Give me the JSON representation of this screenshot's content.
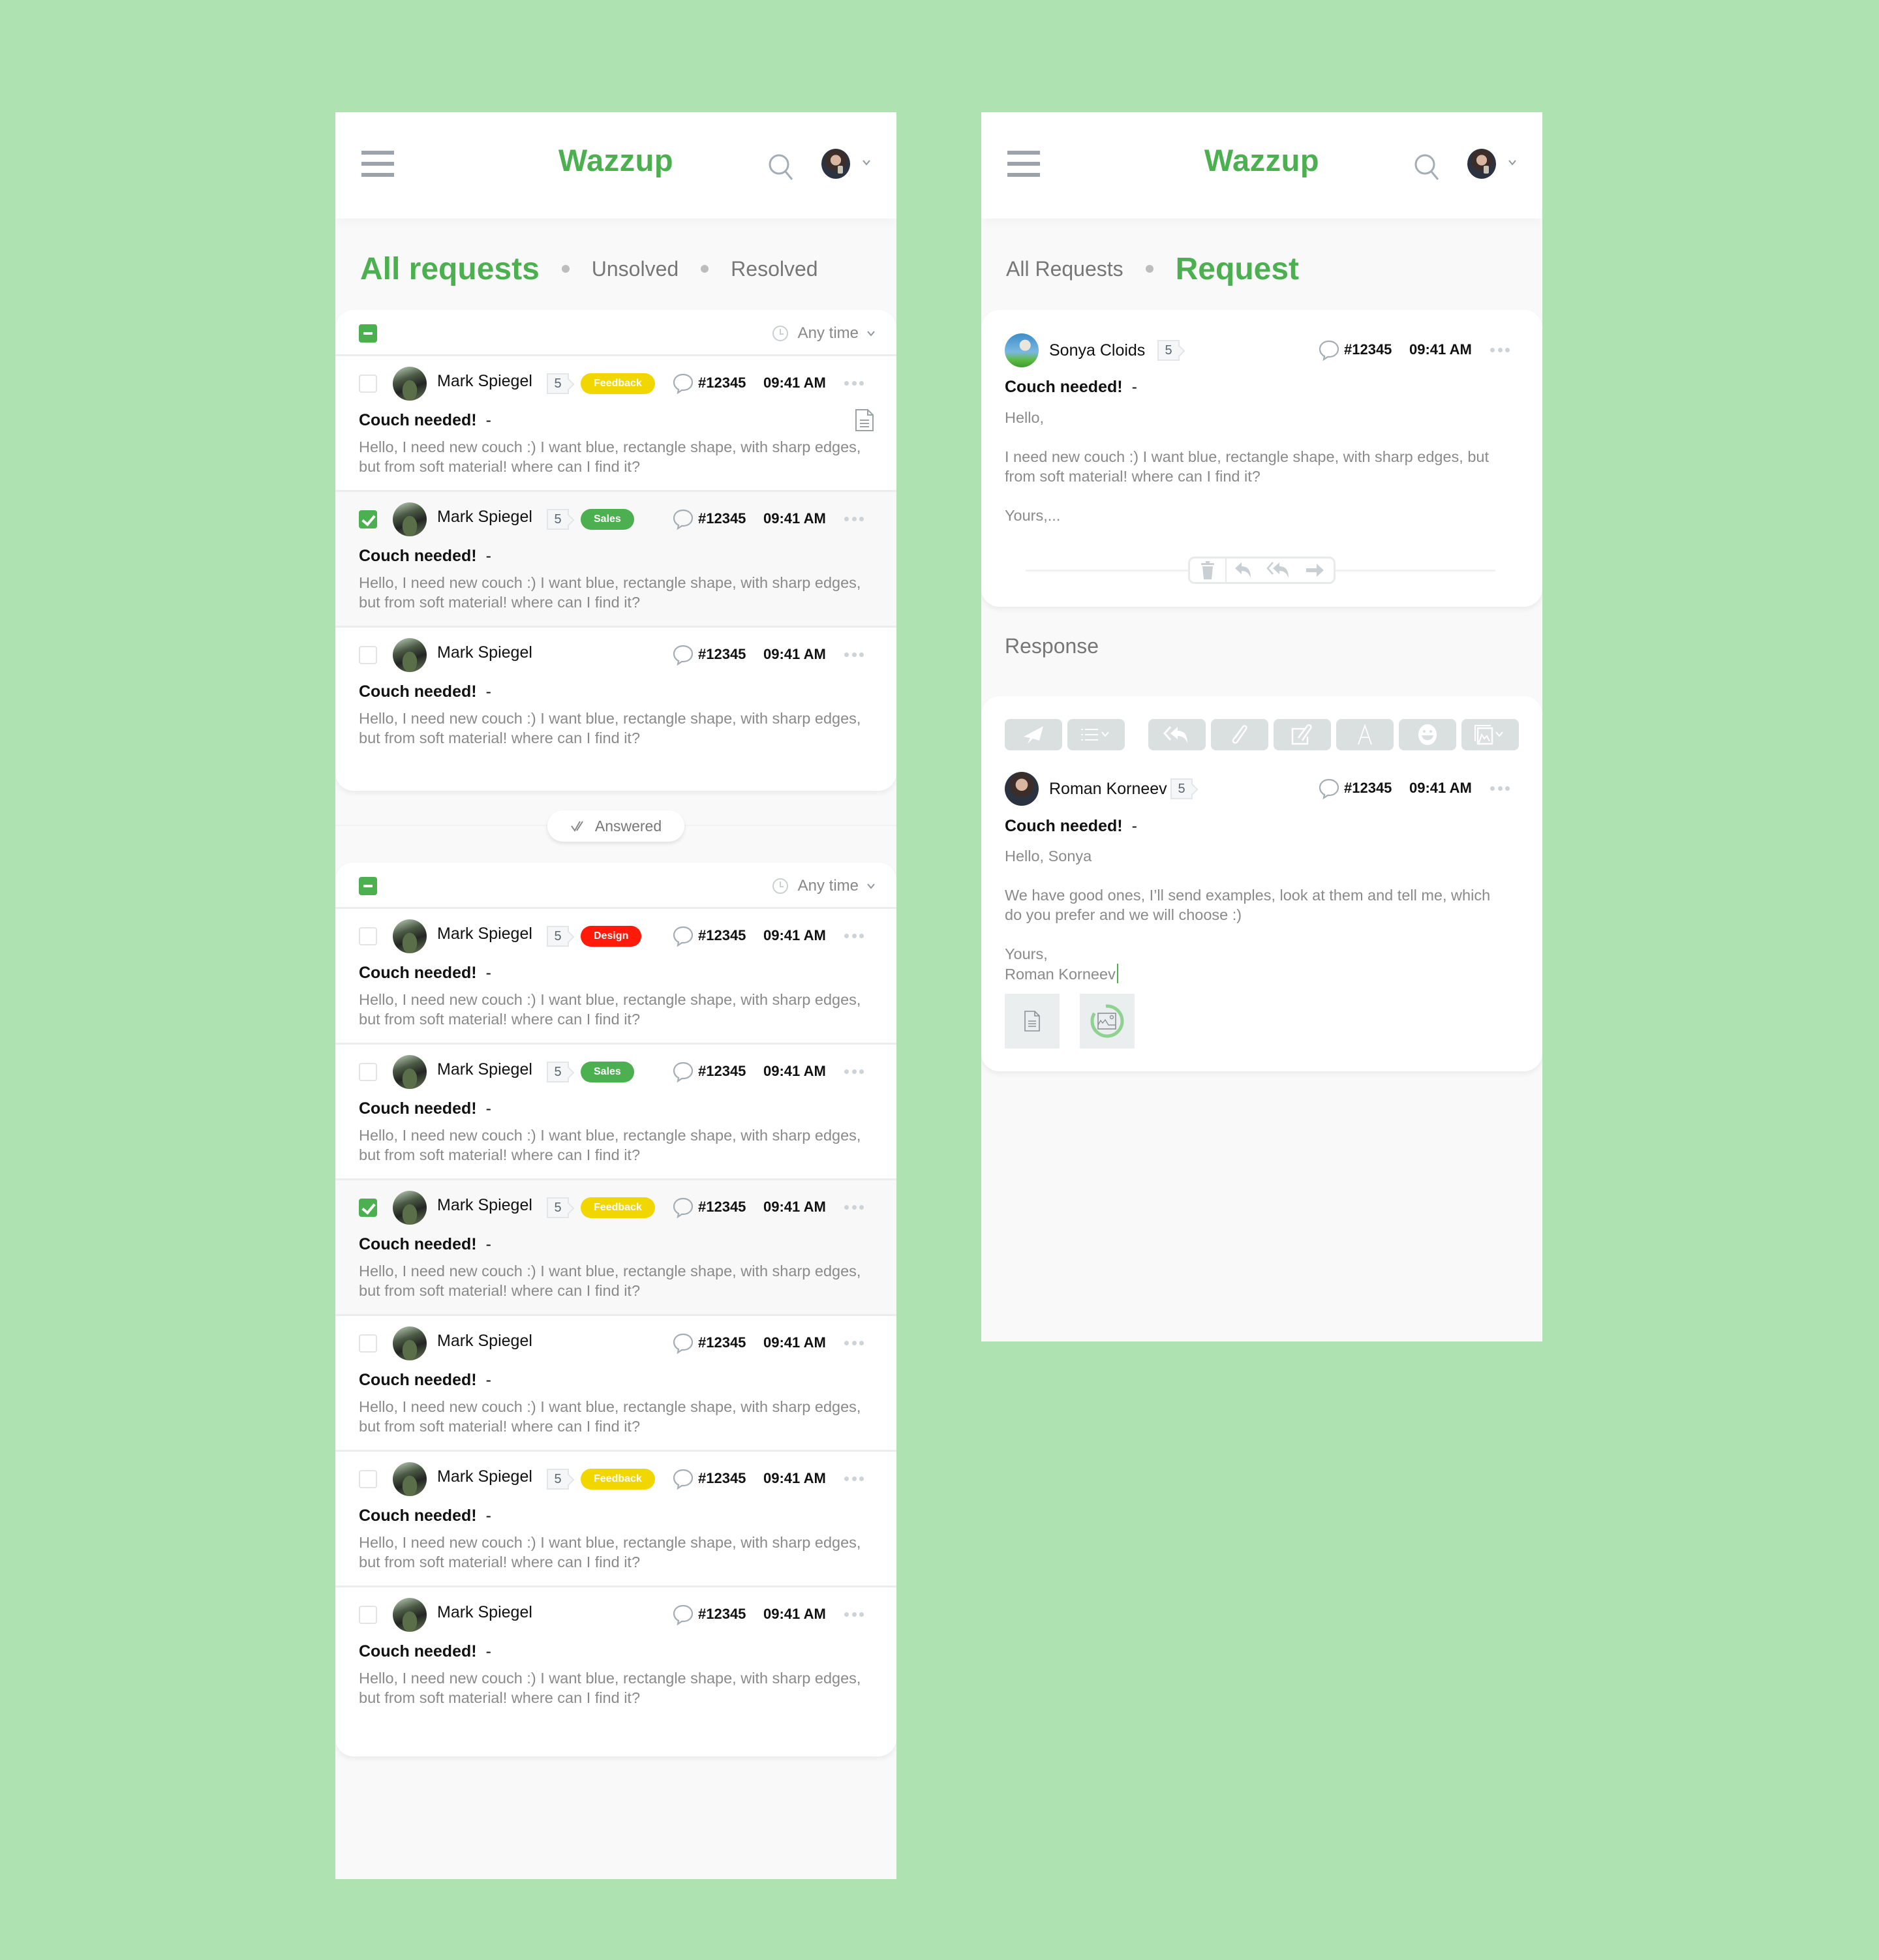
{
  "app": {
    "logo": "Wazzup",
    "accent_color": "#4CAF50",
    "background_color": "#AFE2B1"
  },
  "list_screen": {
    "tabs": [
      {
        "label": "All requests",
        "active": true
      },
      {
        "label": "Unsolved",
        "active": false
      },
      {
        "label": "Resolved",
        "active": false
      }
    ],
    "groups": [
      {
        "time_filter": "Any time",
        "bulk_select": "partial",
        "rows": [
          {
            "sender": "Mark Spiegel",
            "count": "5",
            "tag": "Feedback",
            "tag_color": "#F2D600",
            "ticket": "#12345",
            "time": "09:41 AM",
            "subject": "Couch needed!",
            "dash": "-",
            "preview": "Hello, I need new couch :) I want blue, rectangle shape, with sharp edges, but from soft material! where can I find it?",
            "checked": false,
            "has_attachment": true
          },
          {
            "sender": "Mark Spiegel",
            "count": "5",
            "tag": "Sales",
            "tag_color": "#4CAF50",
            "ticket": "#12345",
            "time": "09:41 AM",
            "subject": "Couch needed!",
            "dash": "-",
            "preview": "Hello, I need new couch :) I want blue, rectangle shape, with sharp edges, but from soft material! where can I find it?",
            "checked": true,
            "has_attachment": false
          },
          {
            "sender": "Mark Spiegel",
            "count": null,
            "tag": null,
            "tag_color": null,
            "ticket": "#12345",
            "time": "09:41 AM",
            "subject": "Couch needed!",
            "dash": "-",
            "preview": "Hello, I need new couch :) I want blue, rectangle shape, with sharp edges, but from soft material! where can I find it?",
            "checked": false,
            "has_attachment": false
          }
        ]
      },
      {
        "time_filter": "Any time",
        "bulk_select": "partial",
        "rows": [
          {
            "sender": "Mark Spiegel",
            "count": "5",
            "tag": "Design",
            "tag_color": "#FF1A0A",
            "ticket": "#12345",
            "time": "09:41 AM",
            "subject": "Couch needed!",
            "dash": "-",
            "preview": "Hello, I need new couch :) I want blue, rectangle shape, with sharp edges, but from soft material! where can I find it?",
            "checked": false,
            "has_attachment": false
          },
          {
            "sender": "Mark Spiegel",
            "count": "5",
            "tag": "Sales",
            "tag_color": "#4CAF50",
            "ticket": "#12345",
            "time": "09:41 AM",
            "subject": "Couch needed!",
            "dash": "-",
            "preview": "Hello, I need new couch :) I want blue, rectangle shape, with sharp edges, but from soft material! where can I find it?",
            "checked": false,
            "has_attachment": false
          },
          {
            "sender": "Mark Spiegel",
            "count": "5",
            "tag": "Feedback",
            "tag_color": "#F2D600",
            "ticket": "#12345",
            "time": "09:41 AM",
            "subject": "Couch needed!",
            "dash": "-",
            "preview": "Hello, I need new couch :) I want blue, rectangle shape, with sharp edges, but from soft material! where can I find it?",
            "checked": true,
            "has_attachment": false
          },
          {
            "sender": "Mark Spiegel",
            "count": null,
            "tag": null,
            "tag_color": null,
            "ticket": "#12345",
            "time": "09:41 AM",
            "subject": "Couch needed!",
            "dash": "-",
            "preview": "Hello, I need new couch :) I want blue, rectangle shape, with sharp edges, but from soft material! where can I find it?",
            "checked": false,
            "has_attachment": false
          },
          {
            "sender": "Mark Spiegel",
            "count": "5",
            "tag": "Feedback",
            "tag_color": "#F2D600",
            "ticket": "#12345",
            "time": "09:41 AM",
            "subject": "Couch needed!",
            "dash": "-",
            "preview": "Hello, I need new couch :) I want blue, rectangle shape, with sharp edges, but from soft material! where can I find it?",
            "checked": false,
            "has_attachment": false
          },
          {
            "sender": "Mark Spiegel",
            "count": null,
            "tag": null,
            "tag_color": null,
            "ticket": "#12345",
            "time": "09:41 AM",
            "subject": "Couch needed!",
            "dash": "-",
            "preview": "Hello, I need new couch :) I want blue, rectangle shape, with sharp edges, but from soft material! where can I find it?",
            "checked": false,
            "has_attachment": false
          }
        ]
      }
    ],
    "divider_label": "Answered"
  },
  "detail_screen": {
    "breadcrumb": {
      "parent": "All Requests",
      "current": "Request"
    },
    "request": {
      "sender": "Sonya Cloids",
      "count": "5",
      "ticket": "#12345",
      "time": "09:41 AM",
      "subject": "Couch needed!",
      "dash": "-",
      "greeting": "Hello,",
      "body": "I need new couch :) I want blue, rectangle shape, with sharp edges, but from soft material! where can I find it?",
      "closing": "Yours,..."
    },
    "actions": [
      "delete",
      "reply",
      "reply-all",
      "forward"
    ],
    "response_label": "Response",
    "toolbar": [
      "send",
      "template-list",
      "reply-all",
      "attach",
      "attach-edit",
      "text-format",
      "emoji",
      "insert-image"
    ],
    "response": {
      "sender": "Roman Korneev",
      "count": "5",
      "ticket": "#12345",
      "time": "09:41 AM",
      "subject": "Couch needed!",
      "dash": "-",
      "greeting": "Hello, Sonya",
      "body": "We have good ones, I’ll send examples, look at them and tell me, which do you prefer and we will choose :)",
      "closing": "Yours,",
      "signature": "Roman Korneev",
      "attachments": [
        {
          "type": "document",
          "upload_progress": 1.0
        },
        {
          "type": "image",
          "upload_progress": 0.85
        }
      ]
    }
  }
}
